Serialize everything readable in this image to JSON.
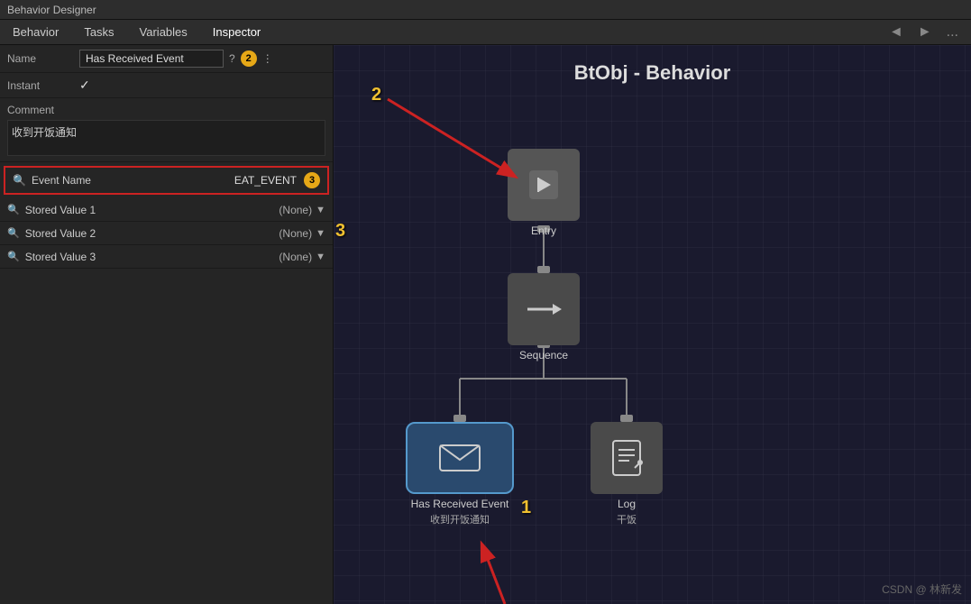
{
  "titleBar": {
    "label": "Behavior Designer"
  },
  "menuBar": {
    "items": [
      "Behavior",
      "Tasks",
      "Variables",
      "Inspector"
    ],
    "navPrev": "◄",
    "navNext": "►",
    "navDots": "..."
  },
  "inspector": {
    "nameLabel": "Name",
    "nameValue": "Has Received Event",
    "badge2": "2",
    "instantLabel": "Instant",
    "instantValue": "✓",
    "commentLabel": "Comment",
    "commentValue": "收到开饭通知",
    "eventNameLabel": "Event Name",
    "eventNameValue": "EAT_EVENT",
    "badge3": "3",
    "storedRows": [
      {
        "label": "Stored Value 1",
        "value": "(None)"
      },
      {
        "label": "Stored Value 2",
        "value": "(None)"
      },
      {
        "label": "Stored Value 3",
        "value": "(None)"
      }
    ]
  },
  "canvas": {
    "title": "BtObj - Behavior",
    "nodes": {
      "entry": {
        "label": "Entry",
        "icon": "⬛"
      },
      "sequence": {
        "label": "Sequence",
        "icon": "→"
      },
      "hasReceivedEvent": {
        "label": "Has Received Event",
        "sublabel": "收到开饭通知",
        "icon": "✉"
      },
      "log": {
        "label": "Log",
        "sublabel": "干饭",
        "icon": "📋"
      }
    },
    "annotations": {
      "badge1": "1",
      "badge2": "2",
      "badge3": "3"
    }
  },
  "watermark": "CSDN @ 林新发"
}
